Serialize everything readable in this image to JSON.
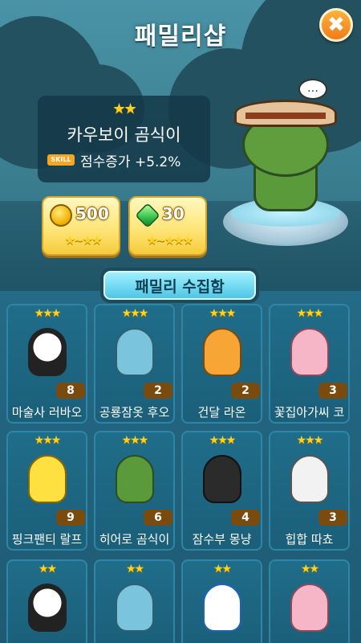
{
  "header": {
    "title": "패밀리샵"
  },
  "close_button": {
    "symbol": "✖"
  },
  "selected_character": {
    "stars": "★★",
    "name": "카우보이 곰식이",
    "skill_badge": "SKILL",
    "skill_text": "점수증가 +5.2%",
    "speech_symbol": "…"
  },
  "purchase_options": [
    {
      "currency": "coin",
      "icon": "coin-icon",
      "amount": "500",
      "star_range": "★~★★"
    },
    {
      "currency": "gem",
      "icon": "gem-icon",
      "amount": "30",
      "star_range": "★~★★★"
    }
  ],
  "collection": {
    "title": "패밀리 수집함",
    "items": [
      {
        "name": "마술사 러바오",
        "stars": "★★★",
        "level": "8",
        "style": "c-panda"
      },
      {
        "name": "공룡잠옷 후오",
        "stars": "★★★",
        "level": "2",
        "style": "c-blue"
      },
      {
        "name": "건달 라온",
        "stars": "★★★",
        "level": "2",
        "style": "c-lion"
      },
      {
        "name": "꽃집아가씨 코",
        "stars": "★★★",
        "level": "3",
        "style": "c-pink"
      },
      {
        "name": "핑크팬티 랄프",
        "stars": "★★★",
        "level": "9",
        "style": "c-yellow"
      },
      {
        "name": "히어로 곰식이",
        "stars": "★★★",
        "level": "6",
        "style": "c-green"
      },
      {
        "name": "잠수부 몽냥",
        "stars": "★★★",
        "level": "4",
        "style": "c-diver"
      },
      {
        "name": "힙합 따쵸",
        "stars": "★★★",
        "level": "3",
        "style": "c-white"
      },
      {
        "name": "",
        "stars": "★★",
        "level": "",
        "style": "c-panda"
      },
      {
        "name": "",
        "stars": "★★",
        "level": "",
        "style": "c-orange"
      },
      {
        "name": "",
        "stars": "★★",
        "level": "",
        "style": "c-helmet"
      },
      {
        "name": "",
        "stars": "★★",
        "level": "",
        "style": "c-pink"
      }
    ]
  },
  "colors": {
    "accent_orange": "#f07c18",
    "star_yellow": "#ffd21e",
    "panel_teal": "#1b5f7a",
    "button_gold": "#ffe67a"
  }
}
